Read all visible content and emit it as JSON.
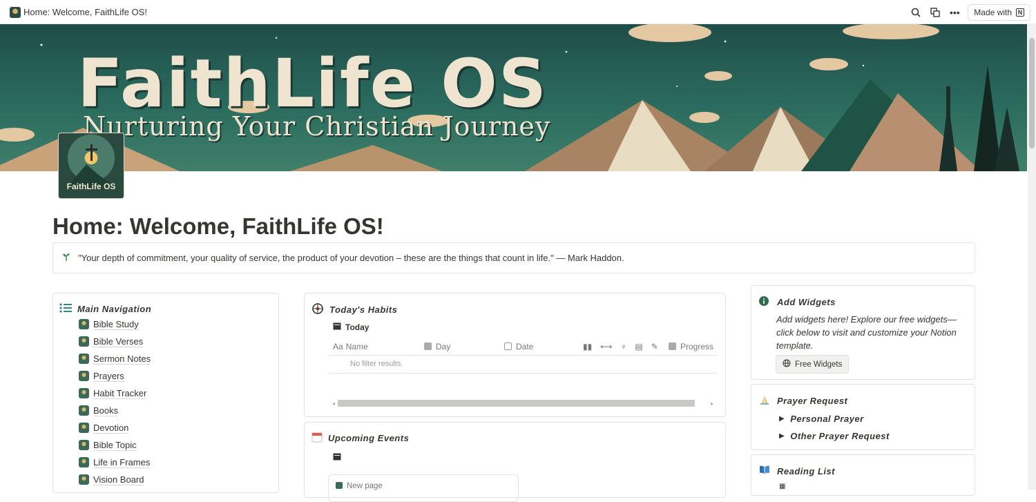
{
  "tab": {
    "title": "Home: Welcome, FaithLife OS!"
  },
  "topbar": {
    "made_with": "Made with"
  },
  "cover": {
    "title": "FaithLife OS",
    "subtitle": "Nurturing Your Christian Journey"
  },
  "icon": {
    "label": "FaithLife OS"
  },
  "page": {
    "title": "Home: Welcome, FaithLife OS!",
    "quote": "\"Your depth of commitment, your quality of service, the product of your devotion – these are the things that count in life.\" — Mark Haddon."
  },
  "nav": {
    "heading": "Main Navigation",
    "items": [
      "Bible Study",
      "Bible Verses",
      "Sermon Notes",
      "Prayers",
      "Habit Tracker",
      "Books",
      "Devotion",
      "Bible Topic",
      "Life in Frames",
      "Vision Board"
    ]
  },
  "habits": {
    "heading": "Today's Habits",
    "view": "Today",
    "columns": {
      "name": "Name",
      "day": "Day",
      "date": "Date",
      "progress": "Progress"
    },
    "empty": "No filter results."
  },
  "events": {
    "heading": "Upcoming Events",
    "new_page": "New page"
  },
  "widgets": {
    "heading": "Add Widgets",
    "text": "Add widgets here! Explore our free widgets—click below to visit and customize your Notion template.",
    "button": "Free Widgets"
  },
  "prayer": {
    "heading": "Prayer Request",
    "items": [
      "Personal Prayer",
      "Other Prayer Request"
    ]
  },
  "reading": {
    "heading": "Reading List"
  }
}
